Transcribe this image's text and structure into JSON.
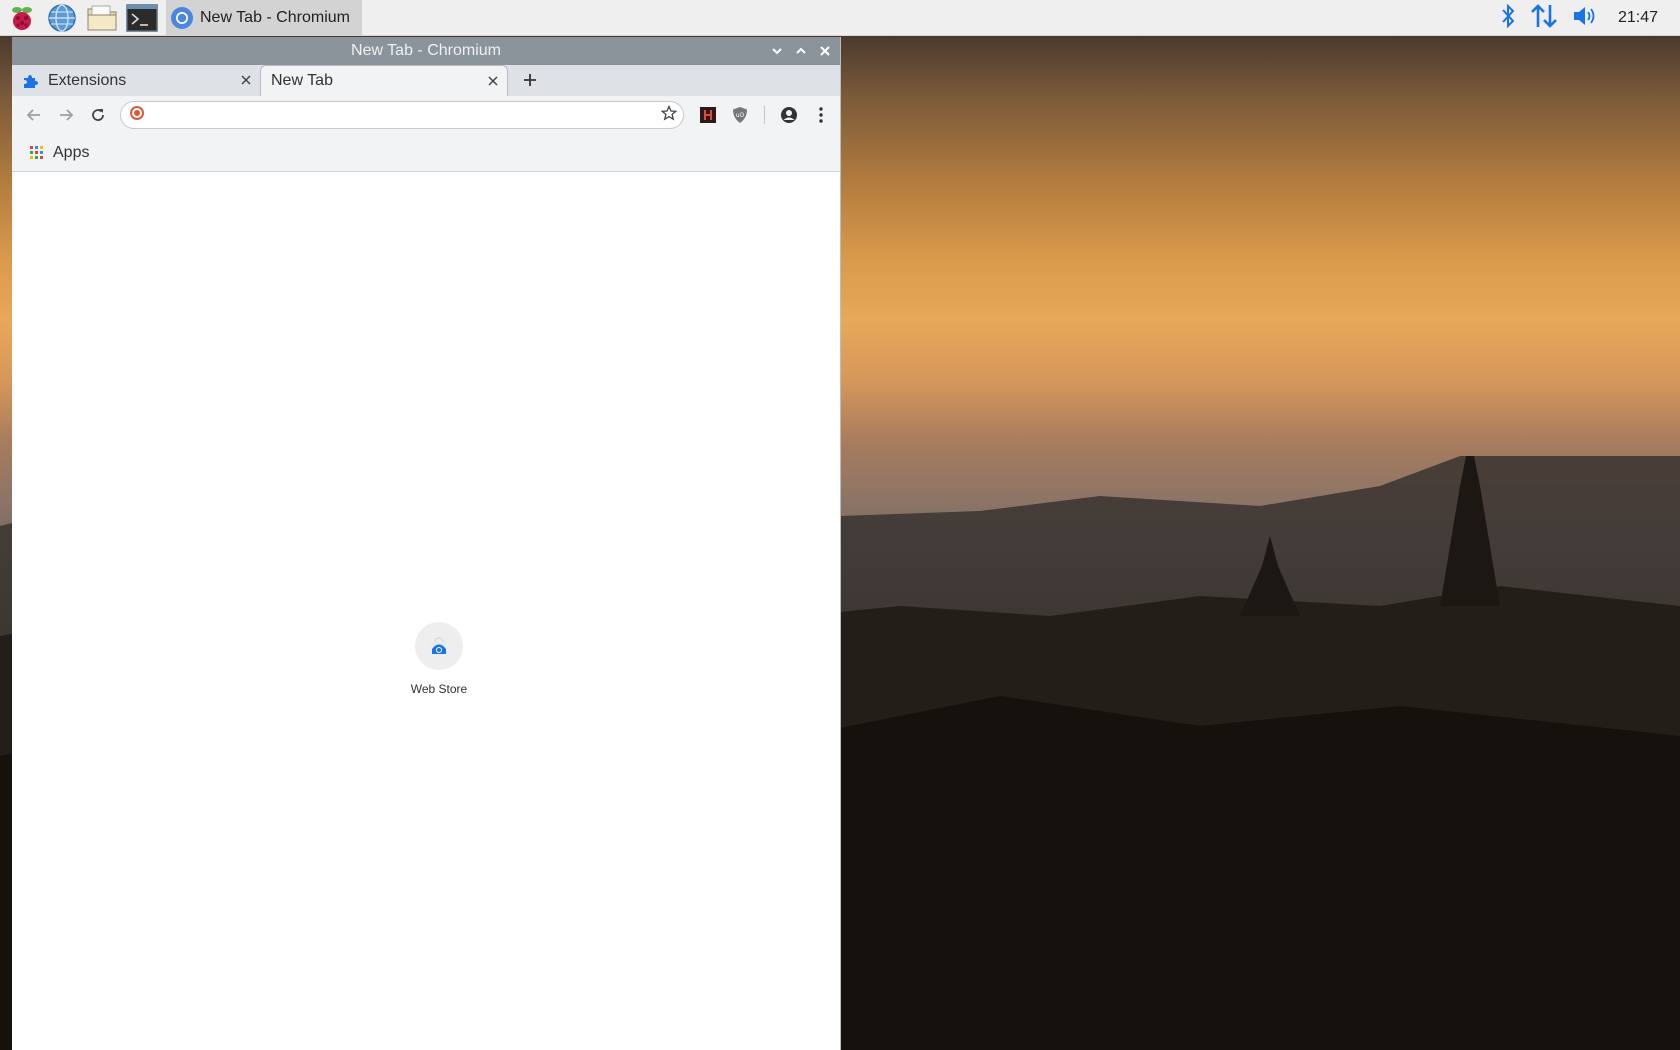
{
  "taskbar": {
    "task_title": "New Tab - Chromium",
    "clock": "21:47",
    "launchers": [
      "raspberry-menu-icon",
      "web-browser-icon",
      "file-manager-icon",
      "terminal-icon"
    ],
    "tray_icons": [
      "bluetooth-icon",
      "network-icon",
      "volume-icon"
    ]
  },
  "window": {
    "title": "New Tab - Chromium",
    "tabs": [
      {
        "label": "Extensions",
        "icon": "puzzle-icon",
        "active": false
      },
      {
        "label": "New Tab",
        "icon": "",
        "active": true
      }
    ],
    "omnibox": {
      "value": "",
      "placeholder": ""
    },
    "bookmarks": {
      "apps_label": "Apps"
    },
    "shortcuts": [
      {
        "label": "Web Store"
      }
    ]
  },
  "colors": {
    "titlebar": "#8c949b",
    "tabstrip": "#dee1e6",
    "toolbar": "#f1f3f4",
    "accent_blue": "#1a73e8"
  }
}
